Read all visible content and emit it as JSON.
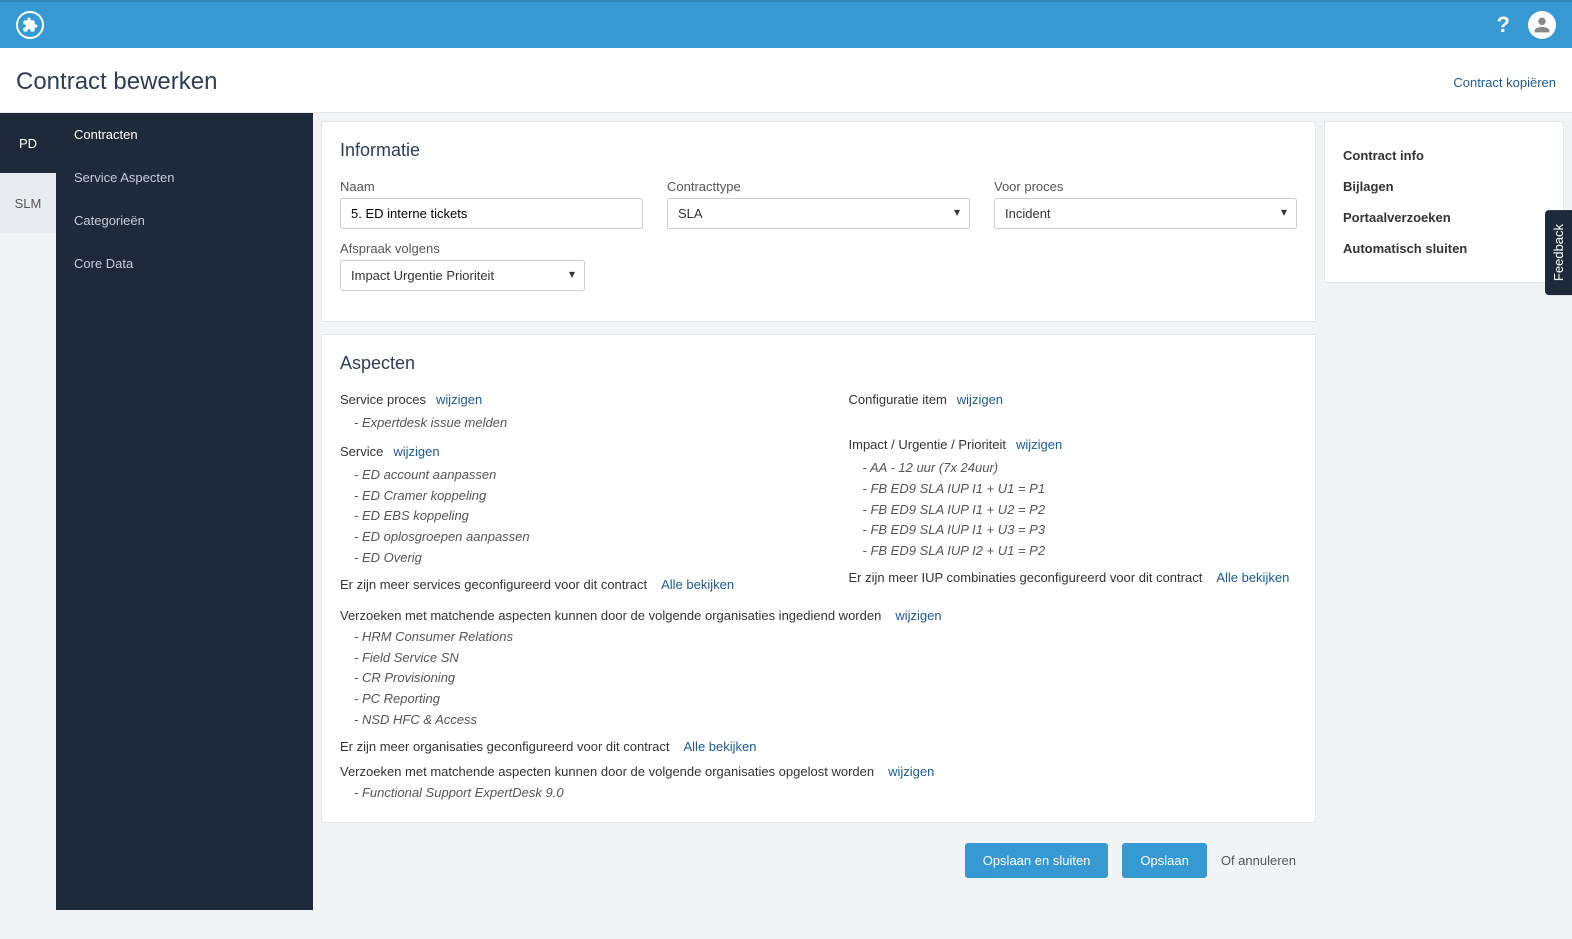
{
  "header": {
    "page_title": "Contract bewerken",
    "copy_action": "Contract kopiëren"
  },
  "sidebar": {
    "tabs": [
      {
        "label": "PD",
        "active": true
      },
      {
        "label": "SLM",
        "active": false
      }
    ],
    "items": [
      {
        "label": "Contracten",
        "active": true
      },
      {
        "label": "Service Aspecten"
      },
      {
        "label": "Categorieën"
      },
      {
        "label": "Core Data"
      }
    ]
  },
  "info": {
    "title": "Informatie",
    "fields": {
      "naam_label": "Naam",
      "naam_value": "5. ED interne tickets",
      "contracttype_label": "Contracttype",
      "contracttype_value": "SLA",
      "voorproces_label": "Voor proces",
      "voorproces_value": "Incident",
      "afspraak_label": "Afspraak volgens",
      "afspraak_value": "Impact Urgentie Prioriteit"
    }
  },
  "aspecten": {
    "title": "Aspecten",
    "wijzigen": "wijzigen",
    "alle_bekijken": "Alle bekijken",
    "service_proces": {
      "label": "Service proces",
      "items": [
        "Expertdesk issue melden"
      ]
    },
    "service": {
      "label": "Service",
      "items": [
        "ED account aanpassen",
        "ED Cramer koppeling",
        "ED EBS koppeling",
        "ED oplosgroepen aanpassen",
        "ED Overig"
      ],
      "more_text": "Er zijn meer services geconfigureerd voor dit contract"
    },
    "config_item": {
      "label": "Configuratie item"
    },
    "iup": {
      "label": "Impact / Urgentie / Prioriteit",
      "items": [
        "AA - 12 uur (7x 24uur)",
        "FB ED9 SLA IUP I1 + U1 = P1",
        "FB ED9 SLA IUP I1 + U2 = P2",
        "FB ED9 SLA IUP I1 + U3 = P3",
        "FB ED9 SLA IUP I2 + U1 = P2"
      ],
      "more_text": "Er zijn meer IUP combinaties geconfigureerd voor dit contract"
    },
    "org_indienen": {
      "label": "Verzoeken met matchende aspecten kunnen door de volgende organisaties ingediend worden",
      "items": [
        "HRM Consumer Relations",
        "Field Service SN",
        "CR Provisioning",
        "PC Reporting",
        "NSD HFC & Access"
      ],
      "more_text": "Er zijn meer organisaties geconfigureerd voor dit contract"
    },
    "org_oplossen": {
      "label": "Verzoeken met matchende aspecten kunnen door de volgende organisaties opgelost worden",
      "items": [
        "Functional Support ExpertDesk 9.0"
      ]
    }
  },
  "right_menu": {
    "items": [
      "Contract info",
      "Bijlagen",
      "Portaalverzoeken",
      "Automatisch sluiten"
    ]
  },
  "footer": {
    "save_close": "Opslaan en sluiten",
    "save": "Opslaan",
    "cancel": "Of annuleren"
  },
  "feedback": "Feedback"
}
